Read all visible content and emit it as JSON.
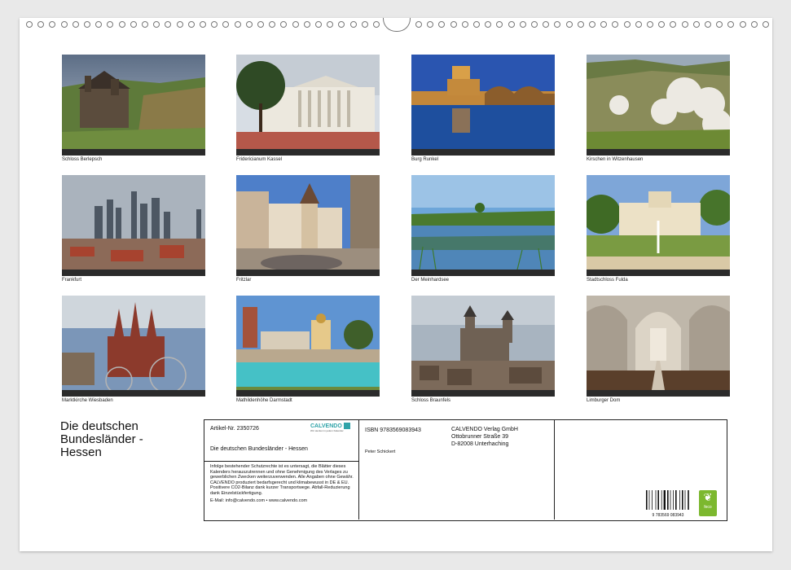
{
  "photos": [
    {
      "caption": "Schloss Berlepsch",
      "icon": "castle-on-hill"
    },
    {
      "caption": "Fridericianum Kassel",
      "icon": "classical-building"
    },
    {
      "caption": "Burg Runkel",
      "icon": "castle-river-night"
    },
    {
      "caption": "Kirschen in Witzenhausen",
      "icon": "blossom-hills"
    },
    {
      "caption": "Frankfurt",
      "icon": "skyline"
    },
    {
      "caption": "Fritzlar",
      "icon": "half-timbered-square"
    },
    {
      "caption": "Der Meinhardsee",
      "icon": "lake"
    },
    {
      "caption": "Stadtschloss Fulda",
      "icon": "palace-fountain"
    },
    {
      "caption": "Marktkirche Wiesbaden",
      "icon": "gothic-church"
    },
    {
      "caption": "Mathildenhöhe Darmstadt",
      "icon": "tower-pool"
    },
    {
      "caption": "Schloss Braunfels",
      "icon": "castle-town"
    },
    {
      "caption": "Limburger Dom",
      "icon": "cathedral-interior"
    }
  ],
  "title": {
    "line1": "Die deutschen",
    "line2": "Bundesländer -",
    "line3": "Hessen"
  },
  "info": {
    "article": "Artikel-Nr. 2350726",
    "calvendo_logo": "CALVENDO",
    "calvendo_sub": "Wir stecken in jedem Kalender",
    "subtitle": "Die deutschen Bundesländer - Hessen",
    "legal": "Infolge bestehender Schutzrechte ist es untersagt, die Blätter dieses Kalenders herauszutrennen und ohne Genehmigung des Verlages zu gewerblichen Zwecken weiterzuverwenden. Alle Angaben ohne Gewähr. CALVENDO produziert bedarfsgerecht und klimabewusst in DE & EU. Positivere CO2-Bilanz dank kurzer Transportwege. Abfall-Reduzierung dank Einzelstückfertigung.",
    "email": "E-Mail: info@calvendo.com • www.calvendo.com",
    "isbn": "ISBN 9783569083943",
    "author": "Peter Schickert",
    "publisher1": "CALVENDO Verlag GmbH",
    "publisher2": "Ottobrunner Straße 39",
    "publisher3": "D-82008 Unterhaching",
    "barcode_text": "9 783569 083943",
    "eco_label": "feco"
  },
  "colors": {
    "accent": "#2fa3a8",
    "eco": "#7cb82f"
  }
}
